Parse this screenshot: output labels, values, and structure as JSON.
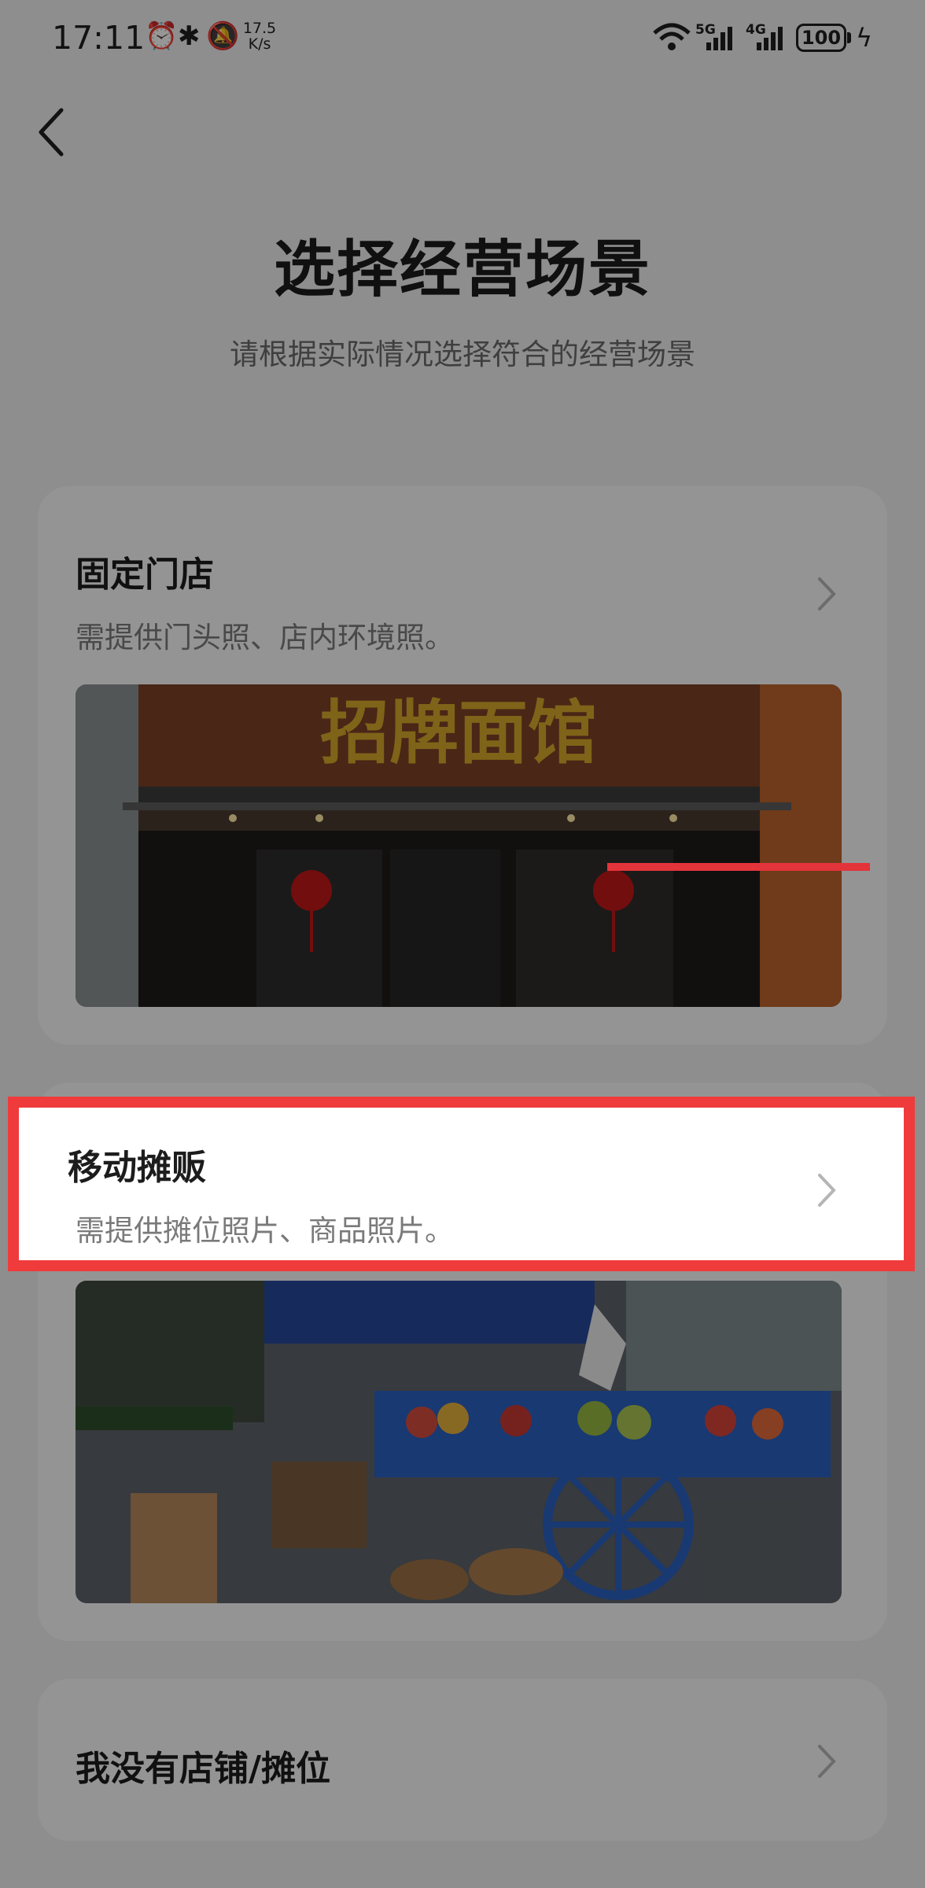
{
  "status_bar": {
    "time": "17:11",
    "net_speed_value": "17.5",
    "net_speed_unit": "K/s",
    "signal_1": "5G",
    "signal_2": "4G",
    "battery": "100"
  },
  "header": {
    "title": "选择经营场景",
    "subtitle": "请根据实际情况选择符合的经营场景"
  },
  "options": [
    {
      "title": "固定门店",
      "desc": "需提供门头照、店内环境照。",
      "image_sign": "招牌面馆"
    },
    {
      "title": "移动摊贩",
      "desc": "需提供摊位照片、商品照片。"
    },
    {
      "title": "我没有店铺/摊位"
    }
  ],
  "colors": {
    "highlight": "#ef3b3b",
    "card_bg": "#f7f7f7",
    "page_bg": "#ededed"
  }
}
